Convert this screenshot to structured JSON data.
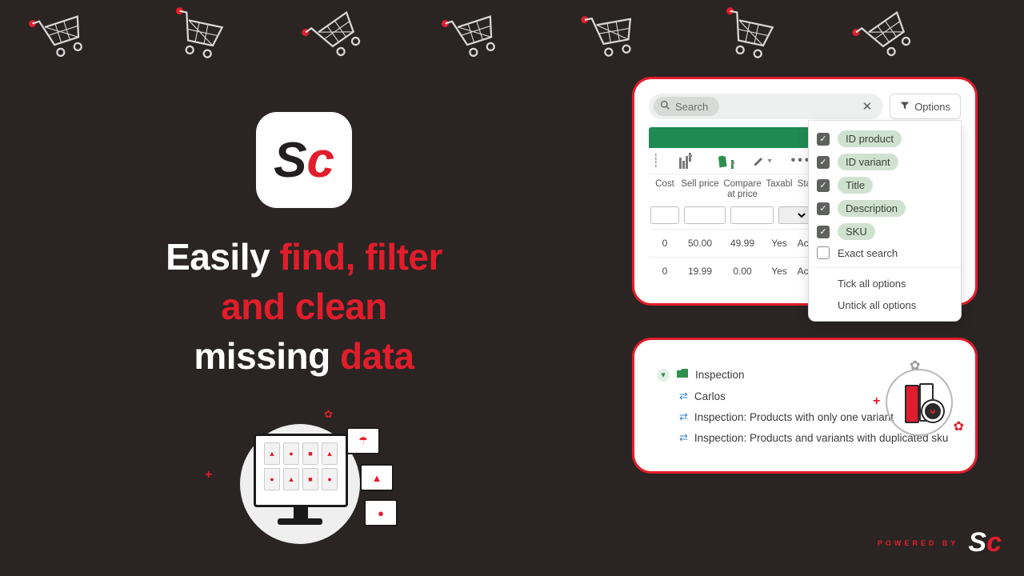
{
  "brand": {
    "s": "S",
    "c": "c",
    "powered_label": "POWERED BY"
  },
  "headline": {
    "w1": "Easily ",
    "w2": "find, filter",
    "w3": "and clean",
    "w4": "missing ",
    "w5": "data"
  },
  "search": {
    "placeholder": "Search",
    "options_label": "Options"
  },
  "columns": {
    "cost": "Cost",
    "sell": "Sell price",
    "compare_l1": "Compare",
    "compare_l2": "at price",
    "taxable": "Taxabl",
    "status": "Status"
  },
  "rows": [
    {
      "cost": "0",
      "sell": "50.00",
      "compare": "49.99",
      "taxable": "Yes",
      "status": "Active"
    },
    {
      "cost": "0",
      "sell": "19.99",
      "compare": "0.00",
      "taxable": "Yes",
      "status": "Active"
    }
  ],
  "dropdown": {
    "items": [
      {
        "label": "ID product",
        "checked": true
      },
      {
        "label": "ID variant",
        "checked": true
      },
      {
        "label": "Title",
        "checked": true
      },
      {
        "label": "Description",
        "checked": true
      },
      {
        "label": "SKU",
        "checked": true
      }
    ],
    "exact": "Exact search",
    "tick": "Tick all options",
    "untick": "Untick all options"
  },
  "tree": {
    "folder": "Inspection",
    "items": [
      "Carlos",
      "Inspection: Products with only one variant",
      "Inspection: Products and variants with duplicated sku"
    ]
  }
}
